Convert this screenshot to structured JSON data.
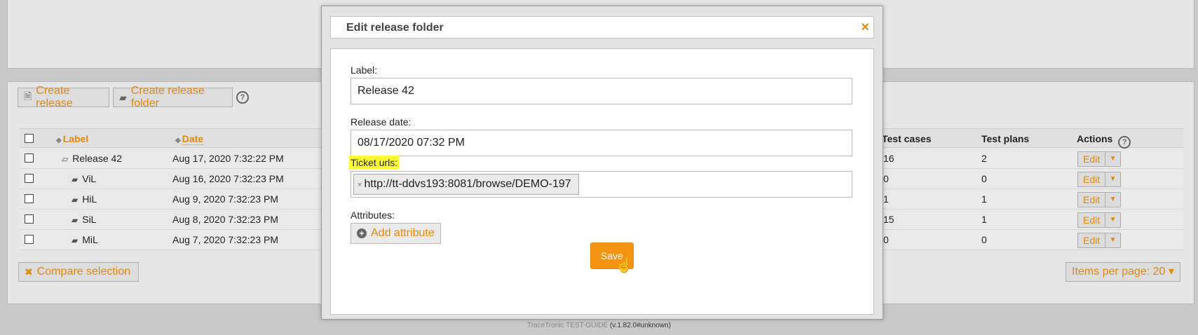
{
  "toolbar": {
    "create_release": "Create release",
    "create_release_folder": "Create release folder",
    "help": "?"
  },
  "table": {
    "headers": {
      "label": "Label",
      "date": "Date",
      "test_cases": "Test cases",
      "test_plans": "Test plans",
      "actions": "Actions"
    },
    "rows": [
      {
        "label": "Release 42",
        "date": "Aug 17, 2020 7:32:22 PM",
        "test_cases": "16",
        "test_plans": "2",
        "edit": "Edit"
      },
      {
        "label": "ViL",
        "date": "Aug 16, 2020 7:32:23 PM",
        "test_cases": "0",
        "test_plans": "0",
        "edit": "Edit"
      },
      {
        "label": "HiL",
        "date": "Aug 9, 2020 7:32:23 PM",
        "test_cases": "1",
        "test_plans": "1",
        "edit": "Edit"
      },
      {
        "label": "SiL",
        "date": "Aug 8, 2020 7:32:23 PM",
        "test_cases": "15",
        "test_plans": "1",
        "edit": "Edit"
      },
      {
        "label": "MiL",
        "date": "Aug 7, 2020 7:32:23 PM",
        "test_cases": "0",
        "test_plans": "0",
        "edit": "Edit"
      }
    ]
  },
  "compare_selection": "Compare selection",
  "items_per_page": "Items per page: 20 ▾",
  "footer": {
    "product": "TraceTronic TEST-GUIDE",
    "version": "(v.1.82.0#unknown)"
  },
  "modal": {
    "title": "Edit release folder",
    "close": "×",
    "label_label": "Label:",
    "label_value": "Release 42",
    "release_date_label": "Release date:",
    "release_date_value": "08/17/2020 07:32 PM",
    "ticket_urls_label": "Ticket urls:",
    "ticket_url": "http://tt-ddvs193:8081/browse/DEMO-197",
    "tag_remove": "×",
    "attributes_label": "Attributes:",
    "add_attribute": "Add attribute",
    "save": "Save"
  },
  "colors": {
    "accent": "#e28a0e",
    "save_button": "#f39512",
    "highlight": "#ffff33"
  }
}
